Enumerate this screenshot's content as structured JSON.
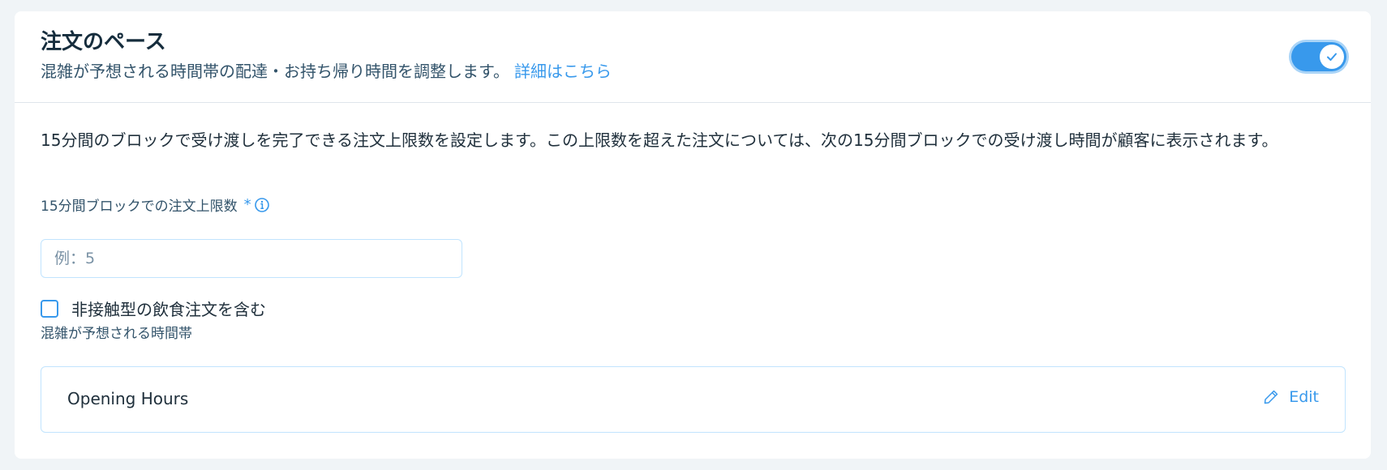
{
  "header": {
    "title": "注文のペース",
    "subtitle": "混雑が予想される時間帯の配達・お持ち帰り時間を調整します。",
    "learn_more": "詳細はこちら",
    "toggle_on": true
  },
  "body": {
    "description": "15分間のブロックで受け渡しを完了できる注文上限数を設定します。この上限数を超えた注文については、次の15分間ブロックでの受け渡し時間が顧客に表示されます。",
    "limit_field": {
      "label": "15分間ブロックでの注文上限数",
      "required_mark": "*",
      "placeholder": "例：5",
      "value": ""
    },
    "checkbox": {
      "label": "非接触型の飲食注文を含む",
      "checked": false
    },
    "busy_hours": {
      "label": "混雑が予想される時間帯",
      "name": "Opening Hours",
      "edit_label": "Edit"
    }
  },
  "colors": {
    "accent": "#3899ec",
    "border": "#c1e4fe",
    "background": "#f0f4f7"
  }
}
